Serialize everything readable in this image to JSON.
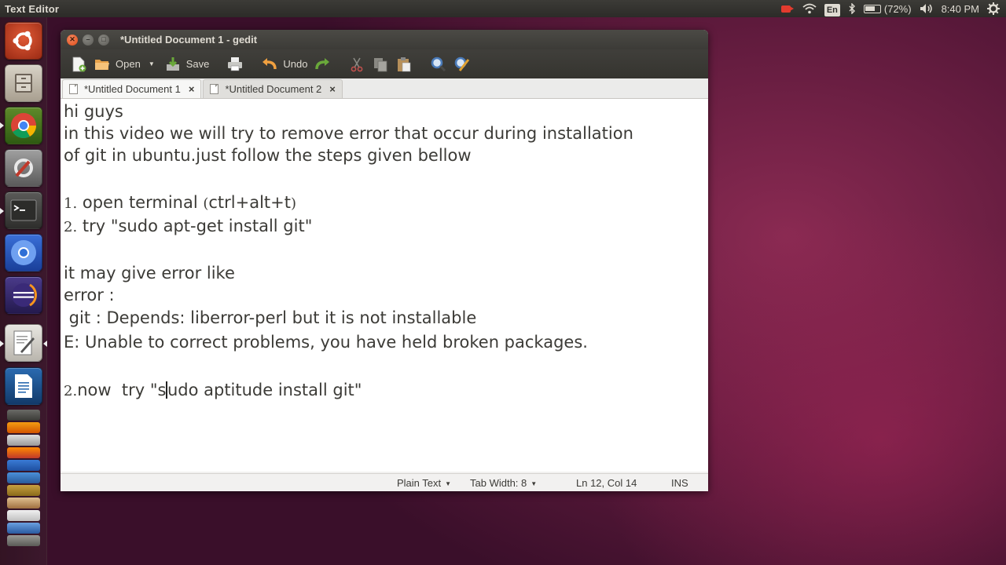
{
  "top_panel": {
    "app_title": "Text Editor",
    "input_language": "En",
    "battery": "(72%)",
    "clock": "8:40 PM"
  },
  "launcher": {
    "items": [
      "ubuntu-dash",
      "files",
      "chrome",
      "system-settings",
      "terminal",
      "chromium",
      "eclipse",
      "gedit",
      "libreoffice-writer",
      "vlc",
      "firefox",
      "thunderbird",
      "software-center",
      "amazon",
      "qbittorrent"
    ]
  },
  "window": {
    "title": "*Untitled Document 1 - gedit",
    "toolbar": {
      "open_label": "Open",
      "save_label": "Save",
      "undo_label": "Undo"
    },
    "tabs": [
      {
        "label": "*Untitled Document 1",
        "close": "×"
      },
      {
        "label": "*Untitled Document 2",
        "close": "×"
      }
    ],
    "editor": {
      "lines": {
        "l1": "hi guys",
        "l2": "in this video we will try to remove error that occur during installation",
        "l3": "of git in ubuntu.just follow the steps given bellow",
        "l5_num": "1.",
        "l5_text": " open terminal ",
        "l5_paren_open": "(",
        "l5_mid": "ctrl+alt+t",
        "l5_paren_close": ")",
        "l6_num": "2.",
        "l6_text": " try \"sudo apt-get install git\"",
        "l8": "it may give error like",
        "l9": "error :",
        "l10": " git : Depends: liberror-perl but it is not installable",
        "l11": "E: Unable to correct problems, you have held broken packages.",
        "l13_num": "2.",
        "l13_a": "now  try \"s",
        "l13_b": "udo aptitude install git\""
      }
    },
    "statusbar": {
      "language": "Plain Text",
      "tab_width": "Tab Width: 8",
      "position": "Ln 12, Col 14",
      "mode": "INS"
    }
  }
}
